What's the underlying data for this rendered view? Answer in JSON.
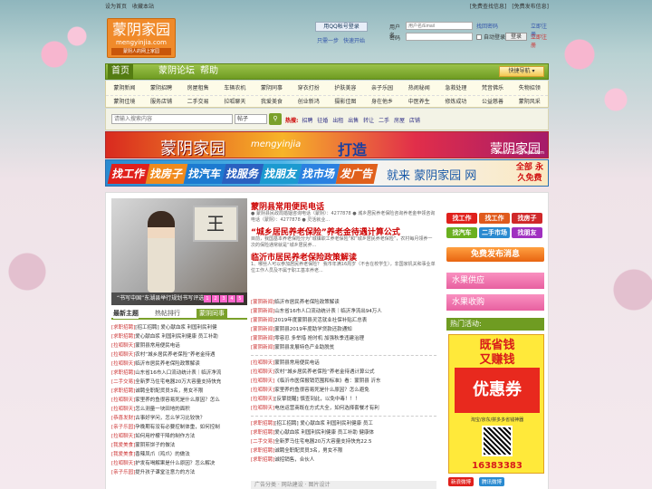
{
  "topbar": {
    "left": [
      "设为首页",
      "收藏本站"
    ],
    "right": [
      "[免费查找信息]",
      "[免费发布信息]"
    ]
  },
  "logo": {
    "cn": "蒙阴家园",
    "en": "mengyinjia.com",
    "tag": "蒙阴人的网上家园"
  },
  "login": {
    "qq_button": "用QQ帐号登录",
    "reg_links": [
      "只需一步",
      "快速开始"
    ],
    "username_label": "用户名",
    "password_label": "密码",
    "username_placeholder": "用户名/Email",
    "autologin": "自动登录",
    "login_button": "登录",
    "forgot": "找回密码",
    "register": "立即注册",
    "signup_link": "立即注册"
  },
  "nav": {
    "items": [
      "首页",
      "蒙阴论坛",
      "帮助"
    ],
    "quick_nav": "快捷导航 ▾"
  },
  "subnav": {
    "row1": [
      "蒙阴新闻",
      "蒙阴招聘",
      "房屋租售",
      "车辆农机",
      "蒙阴同事",
      "穿衣打扮",
      "护肤美容",
      "亲子乐园",
      "热闹秘闻",
      "急救处理",
      "梵音佛乐",
      "失物招领"
    ],
    "row2": [
      "蒙阴佳境",
      "服务店铺",
      "二手交易",
      "拉呱聊天",
      "我爱美食",
      "创业新鸿",
      "摄影佳图",
      "身在他乡",
      "中医养生",
      "修炼成功",
      "公益慈善",
      "蒙阴风采"
    ]
  },
  "search": {
    "placeholder": "请输入搜索内容",
    "select": "帖子",
    "button_icon": "magnifier",
    "hot_label": "热搜:",
    "hot_words": [
      "招聘",
      "征婚",
      "出租",
      "出售",
      "转让",
      "二手",
      "房屋",
      "店铺"
    ]
  },
  "banner1": {
    "title": "蒙阴家园",
    "domain": "mengyinjia",
    "slogan": "打造",
    "right_title": "蒙阴家园",
    "right_url": "www.mengyinjia.com"
  },
  "banner2": {
    "pills": [
      "找工作",
      "找房子",
      "找汽车",
      "找服务",
      "找朋友",
      "找市场",
      "发广告"
    ],
    "word": "就来 蒙阴家园 网",
    "right": "全部 永久免费"
  },
  "photo": {
    "board_char": "王",
    "caption": "“书写中国”东湖县举行规划书写评选",
    "dots": [
      "1",
      "2",
      "3",
      "4",
      "5"
    ]
  },
  "tabs": [
    "最新主题",
    "热帖排行",
    "蒙阴同事"
  ],
  "left_list": [
    {
      "c": "[求职招聘]",
      "t": "[招工招聘] 爱心献血浆 利国利民利健"
    },
    {
      "c": "[求职招聘]",
      "t": "爱心献血浆 利国利民利健康 员工补助"
    },
    {
      "c": "[拉呱聊天]",
      "t": "蒙阴县常用便民电话"
    },
    {
      "c": "[拉呱聊天]",
      "t": "农村“城乡居民养老保险”养老金待遇"
    },
    {
      "c": "[拉呱聊天]",
      "t": "临沂市居民养老保险政策解读"
    },
    {
      "c": "[求职招聘]",
      "t": "山东省16市入口流动统计表｜临沂净流"
    },
    {
      "c": "[二手交易]",
      "t": "全新罗马住宅电器20万大容量支持快充"
    },
    {
      "c": "[求职招聘]",
      "t": "诚聘全职配货员3名，男女不限"
    },
    {
      "c": "[拉呱聊天]",
      "t": "家里养的鱼很容易死是什么原因？怎么"
    },
    {
      "c": "[拉呱聊天]",
      "t": "怎么测量一块田地的面积"
    },
    {
      "c": "[恭喜发财]",
      "t": "古事好学问，怎么学习比较快？"
    },
    {
      "c": "[亲子乐园]",
      "t": "孕晚期有没有必要控制体重，如何控制"
    },
    {
      "c": "[拉呱聊天]",
      "t": "如何用柠檬干降的制作方法"
    },
    {
      "c": "[我爱美食]",
      "t": "蒙阴煎饼子的做法"
    },
    {
      "c": "[我爱美食]",
      "t": "香辣凤爪（鸡爪）的做法"
    },
    {
      "c": "[拉呱聊天]",
      "t": "护发有喝解果是什么原因？怎么解决"
    },
    {
      "c": "[亲子乐园]",
      "t": "提升孩子课堂注意力的方法"
    }
  ],
  "headline": {
    "h1": "蒙阴县常用便民电话",
    "p1": "● 蒙阴县民政局婚姻咨询电话（蒙阴）：4277878 ● 城乡居民养老保险咨询养老金申领咨询电话（蒙阴）：4277878 ● 灵活就业...",
    "h1b": "“城乡居民养老保险”养老金待遇计算公式",
    "p2": "目前，我国基本养老保险分为“城镇职工养老保险”和“城乡居民养老保险”，农村每月领养一次的保险通常就是“城乡居民养...",
    "h2": "临沂市居民养老保险政策解读",
    "p3": "1、哪些人可以参加居民养老保险？ 我市年满16周岁（不含在校学生），非国家机关和事业单位工作人员及不属于职工基本养老..."
  },
  "mid_list_a": [
    {
      "c": "[蒙阴新闻]",
      "t": "临沂市居民养老保险政策解读"
    },
    {
      "c": "[蒙阴新闻]",
      "t": "山东省16市人口流动统计表｜临沂净流出94万人"
    },
    {
      "c": "[蒙阴新闻]",
      "t": "2019年度蒙阴县灵活就业社保补贴汇总表"
    },
    {
      "c": "[蒙阴新闻]",
      "t": "蒙阴县2019年度助学贷款还款通知"
    },
    {
      "c": "[蒙阴新闻]",
      "t": "零容忍 多举措 抢时机 加强秋季违建治理"
    },
    {
      "c": "[蒙阴新闻]",
      "t": "蒙阴县发展特色产业助脱贫"
    }
  ],
  "mid_list_b": [
    {
      "c": "[拉呱聊天]",
      "t": "蒙阴县常用便民电话"
    },
    {
      "c": "[拉呱聊天]",
      "t": "农村“城乡居民养老保险”养老金待遇计算公式"
    },
    {
      "c": "[拉呱聊天]",
      "t": "《临沂市医保报销范围和标准》看：蒙阴县 沂东"
    },
    {
      "c": "[拉呱聊天]",
      "t": "家里养的鱼很容易死是什么原因？怎么避免"
    },
    {
      "c": "[拉呱聊天]",
      "t": "[反擎提醒] 慎查到此，以免中毒！！！"
    },
    {
      "c": "[拉呱聊天]",
      "t": "电信运营商既在方式大全，如何选择套餐才有利"
    }
  ],
  "mid_list_c": [
    {
      "c": "[求职招聘]",
      "t": "[招工招聘] 爱心献血浆 利国利民利健康 员工"
    },
    {
      "c": "[求职招聘]",
      "t": "爱心献血浆 利国利民利健康 员工补助 健康体"
    },
    {
      "c": "[二手交易]",
      "t": "全新罗马住宅电器20万大容量支持快充22.5"
    },
    {
      "c": "[求职招聘]",
      "t": "诚聘全职配货员3名，男女不限"
    },
    {
      "c": "[求职招聘]",
      "t": "诚招销售，合伙人"
    }
  ],
  "right": {
    "tiles": [
      {
        "label": "找工作",
        "color": "#e0201c"
      },
      {
        "label": "找工作",
        "color": "#e05a1c"
      },
      {
        "label": "找房子",
        "color": "#d0282a"
      },
      {
        "label": "找汽车",
        "color": "#6ab020"
      },
      {
        "label": "二手市场",
        "color": "#2a8ad0"
      },
      {
        "label": "找朋友",
        "color": "#a030c0"
      }
    ],
    "publish": "免费发布消息",
    "supply": "水果供应",
    "purchase": "水果收购",
    "hot_title": "热门活动:",
    "ad_line1": "既省钱",
    "ad_line1b": "又赚钱",
    "ad_coupon": "优惠券",
    "ad_sub": "淘宝/京东/拼多多省钱神器",
    "ad_phone": "16383383",
    "shares": [
      {
        "label": "新浪微博",
        "color": "#e0201c"
      },
      {
        "label": "腾讯微博",
        "color": "#2a8ad0"
      }
    ]
  },
  "bottom": "广告分类 · 网站建设 · 图片设计"
}
